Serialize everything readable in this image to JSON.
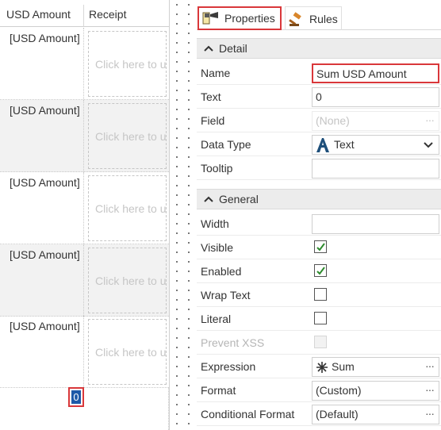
{
  "grid": {
    "columns": [
      "USD Amount",
      "Receipt"
    ],
    "rows": [
      {
        "usd": "[USD Amount]",
        "receipt_placeholder": "Click here to upload"
      },
      {
        "usd": "[USD Amount]",
        "receipt_placeholder": "Click here to upload"
      },
      {
        "usd": "[USD Amount]",
        "receipt_placeholder": "Click here to upload"
      },
      {
        "usd": "[USD Amount]",
        "receipt_placeholder": "Click here to upload"
      },
      {
        "usd": "[USD Amount]",
        "receipt_placeholder": "Click here to upload"
      }
    ],
    "footer_sum": "0"
  },
  "panel": {
    "tabs": [
      {
        "label": "Properties",
        "icon": "properties-icon",
        "active": true
      },
      {
        "label": "Rules",
        "icon": "gavel-icon",
        "active": false
      }
    ],
    "sections": {
      "detail": "Detail",
      "general": "General"
    },
    "detail": {
      "name": {
        "label": "Name",
        "value": "Sum USD Amount"
      },
      "text": {
        "label": "Text",
        "value": "0"
      },
      "field": {
        "label": "Field",
        "value": "(None)"
      },
      "data_type": {
        "label": "Data Type",
        "value": "Text"
      },
      "tooltip": {
        "label": "Tooltip",
        "value": ""
      }
    },
    "general": {
      "width": {
        "label": "Width",
        "value": ""
      },
      "visible": {
        "label": "Visible",
        "checked": true
      },
      "enabled": {
        "label": "Enabled",
        "checked": true
      },
      "wrap_text": {
        "label": "Wrap Text",
        "checked": false
      },
      "literal": {
        "label": "Literal",
        "checked": false
      },
      "prevent_xss": {
        "label": "Prevent XSS",
        "checked": false,
        "disabled": true
      },
      "expression": {
        "label": "Expression",
        "value": "Sum"
      },
      "format": {
        "label": "Format",
        "value": "(Custom)"
      },
      "conditional_format": {
        "label": "Conditional Format",
        "value": "(Default)"
      }
    },
    "ellipsis": "···"
  },
  "colors": {
    "highlight_red": "#d9373a",
    "checkmark_green": "#2e8b2e",
    "section_bg": "#ececec",
    "text_type_icon": "#1e4f7a"
  }
}
